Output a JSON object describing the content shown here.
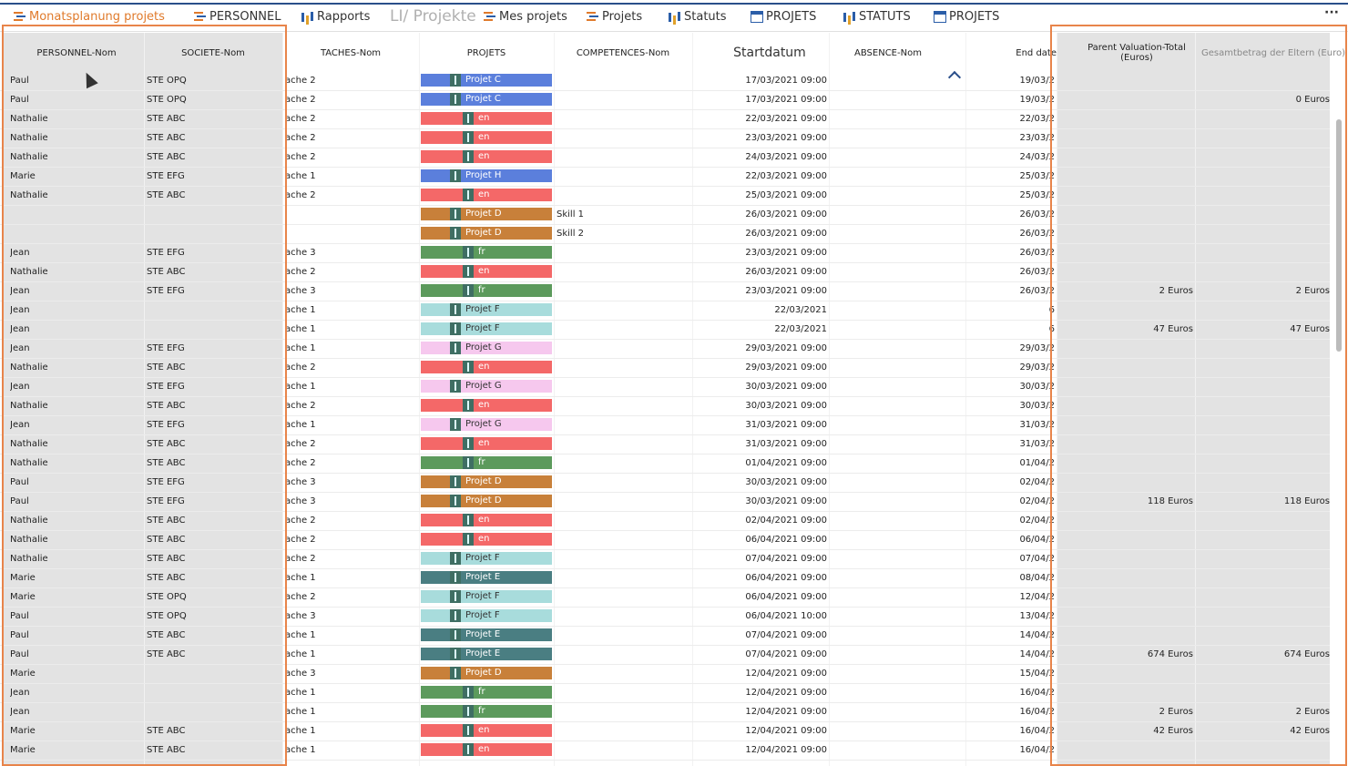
{
  "toolbar": {
    "tabs": [
      {
        "label": "Monatsplanung projets",
        "icon": "gantt-icon",
        "active": true
      },
      {
        "label": "PERSONNEL",
        "icon": "gantt-icon"
      },
      {
        "label": "Rapports",
        "icon": "bar-chart-icon"
      },
      {
        "label": "LI/ Projekte",
        "icon": ""
      },
      {
        "label": "Mes projets",
        "icon": "gantt-icon"
      },
      {
        "label": "Projets",
        "icon": "gantt-icon"
      },
      {
        "label": "Statuts",
        "icon": "bar-chart-icon"
      },
      {
        "label": "PROJETS",
        "icon": "table-icon"
      },
      {
        "label": "STATUTS",
        "icon": "bar-chart-icon"
      },
      {
        "label": "PROJETS",
        "icon": "table-icon"
      }
    ],
    "more_label": "···"
  },
  "columns": [
    "PERSONNEL-Nom",
    "SOCIETE-Nom",
    "TACHES-Nom",
    "PROJETS",
    "COMPETENCES-Nom",
    "Startdatum",
    "ABSENCE-Nom",
    "End date",
    "Parent Valuation-Total (Euros)",
    "Gesamtbetrag der Eltern (Euro)"
  ],
  "colors": {
    "projet_c": "#5b7fdc",
    "en": "#f46868",
    "projet_h": "#5b7fdc",
    "projet_d": "#c8803a",
    "fr": "#5c9a5c",
    "projet_f": "#a8dcdc",
    "projet_g": "#f6c8ee",
    "projet_e": "#4a7e82",
    "accent": "#e8844a"
  },
  "rows": [
    {
      "person": "Paul",
      "company": "STE OPQ",
      "task": "ache 2",
      "project": "Projet C",
      "pc": "projet_c",
      "skill": "",
      "start": "17/03/2021 09:00",
      "end": "19/03/2",
      "total": "",
      "total2": ""
    },
    {
      "person": "Paul",
      "company": "STE OPQ",
      "task": "ache 2",
      "project": "Projet C",
      "pc": "projet_c",
      "skill": "",
      "start": "17/03/2021 09:00",
      "end": "19/03/2",
      "total": "",
      "total2": "0 Euros"
    },
    {
      "person": "Nathalie",
      "company": "STE ABC",
      "task": "ache 2",
      "project": "en",
      "pc": "en",
      "skill": "",
      "start": "22/03/2021 09:00",
      "end": "22/03/2",
      "total": "",
      "total2": ""
    },
    {
      "person": "Nathalie",
      "company": "STE ABC",
      "task": "ache 2",
      "project": "en",
      "pc": "en",
      "skill": "",
      "start": "23/03/2021 09:00",
      "end": "23/03/2",
      "total": "",
      "total2": ""
    },
    {
      "person": "Nathalie",
      "company": "STE ABC",
      "task": "ache 2",
      "project": "en",
      "pc": "en",
      "skill": "",
      "start": "24/03/2021 09:00",
      "end": "24/03/2",
      "total": "",
      "total2": ""
    },
    {
      "person": "Marie",
      "company": "STE EFG",
      "task": "ache 1",
      "project": "Projet H",
      "pc": "projet_h",
      "skill": "",
      "start": "22/03/2021 09:00",
      "end": "25/03/2",
      "total": "",
      "total2": ""
    },
    {
      "person": "Nathalie",
      "company": "STE ABC",
      "task": "ache 2",
      "project": "en",
      "pc": "en",
      "skill": "",
      "start": "25/03/2021 09:00",
      "end": "25/03/2",
      "total": "",
      "total2": ""
    },
    {
      "person": "",
      "company": "",
      "task": "",
      "project": "Projet D",
      "pc": "projet_d",
      "skill": "Skill 1",
      "start": "26/03/2021 09:00",
      "end": "26/03/2",
      "total": "",
      "total2": ""
    },
    {
      "person": "",
      "company": "",
      "task": "",
      "project": "Projet D",
      "pc": "projet_d",
      "skill": "Skill 2",
      "start": "26/03/2021 09:00",
      "end": "26/03/2",
      "total": "",
      "total2": ""
    },
    {
      "person": "Jean",
      "company": "STE EFG",
      "task": "ache 3",
      "project": "fr",
      "pc": "fr",
      "skill": "",
      "start": "23/03/2021 09:00",
      "end": "26/03/2",
      "total": "",
      "total2": ""
    },
    {
      "person": "Nathalie",
      "company": "STE ABC",
      "task": "ache 2",
      "project": "en",
      "pc": "en",
      "skill": "",
      "start": "26/03/2021 09:00",
      "end": "26/03/2",
      "total": "",
      "total2": ""
    },
    {
      "person": "Jean",
      "company": "STE EFG",
      "task": "ache 3",
      "project": "fr",
      "pc": "fr",
      "skill": "",
      "start": "23/03/2021 09:00",
      "end": "26/03/2",
      "total": "2 Euros",
      "total2": "2 Euros"
    },
    {
      "person": "Jean",
      "company": "",
      "task": "ache 1",
      "project": "Projet F",
      "pc": "projet_f",
      "skill": "",
      "start": "22/03/2021",
      "end": "6",
      "total": "",
      "total2": ""
    },
    {
      "person": "Jean",
      "company": "",
      "task": "ache 1",
      "project": "Projet F",
      "pc": "projet_f",
      "skill": "",
      "start": "22/03/2021",
      "end": "6",
      "total": "47 Euros",
      "total2": "47 Euros"
    },
    {
      "person": "Jean",
      "company": "STE EFG",
      "task": "ache 1",
      "project": "Projet G",
      "pc": "projet_g",
      "skill": "",
      "start": "29/03/2021 09:00",
      "end": "29/03/2",
      "total": "",
      "total2": ""
    },
    {
      "person": "Nathalie",
      "company": "STE ABC",
      "task": "ache 2",
      "project": "en",
      "pc": "en",
      "skill": "",
      "start": "29/03/2021 09:00",
      "end": "29/03/2",
      "total": "",
      "total2": ""
    },
    {
      "person": "Jean",
      "company": "STE EFG",
      "task": "ache 1",
      "project": "Projet G",
      "pc": "projet_g",
      "skill": "",
      "start": "30/03/2021 09:00",
      "end": "30/03/2",
      "total": "",
      "total2": ""
    },
    {
      "person": "Nathalie",
      "company": "STE ABC",
      "task": "ache 2",
      "project": "en",
      "pc": "en",
      "skill": "",
      "start": "30/03/2021 09:00",
      "end": "30/03/2",
      "total": "",
      "total2": ""
    },
    {
      "person": "Jean",
      "company": "STE EFG",
      "task": "ache 1",
      "project": "Projet G",
      "pc": "projet_g",
      "skill": "",
      "start": "31/03/2021 09:00",
      "end": "31/03/2",
      "total": "",
      "total2": ""
    },
    {
      "person": "Nathalie",
      "company": "STE ABC",
      "task": "ache 2",
      "project": "en",
      "pc": "en",
      "skill": "",
      "start": "31/03/2021 09:00",
      "end": "31/03/2",
      "total": "",
      "total2": ""
    },
    {
      "person": "Nathalie",
      "company": "STE ABC",
      "task": "ache 2",
      "project": "fr",
      "pc": "fr",
      "skill": "",
      "start": "01/04/2021 09:00",
      "end": "01/04/2",
      "total": "",
      "total2": ""
    },
    {
      "person": "Paul",
      "company": "STE EFG",
      "task": "ache 3",
      "project": "Projet D",
      "pc": "projet_d",
      "skill": "",
      "start": "30/03/2021 09:00",
      "end": "02/04/2",
      "total": "",
      "total2": ""
    },
    {
      "person": "Paul",
      "company": "STE EFG",
      "task": "ache 3",
      "project": "Projet D",
      "pc": "projet_d",
      "skill": "",
      "start": "30/03/2021 09:00",
      "end": "02/04/2",
      "total": "118 Euros",
      "total2": "118 Euros"
    },
    {
      "person": "Nathalie",
      "company": "STE ABC",
      "task": "ache 2",
      "project": "en",
      "pc": "en",
      "skill": "",
      "start": "02/04/2021 09:00",
      "end": "02/04/2",
      "total": "",
      "total2": ""
    },
    {
      "person": "Nathalie",
      "company": "STE ABC",
      "task": "ache 2",
      "project": "en",
      "pc": "en",
      "skill": "",
      "start": "06/04/2021 09:00",
      "end": "06/04/2",
      "total": "",
      "total2": ""
    },
    {
      "person": "Nathalie",
      "company": "STE ABC",
      "task": "ache 2",
      "project": "Projet F",
      "pc": "projet_f",
      "skill": "",
      "start": "07/04/2021 09:00",
      "end": "07/04/2",
      "total": "",
      "total2": ""
    },
    {
      "person": "Marie",
      "company": "STE ABC",
      "task": "ache 1",
      "project": "Projet E",
      "pc": "projet_e",
      "skill": "",
      "start": "06/04/2021 09:00",
      "end": "08/04/2",
      "total": "",
      "total2": ""
    },
    {
      "person": "Marie",
      "company": "STE OPQ",
      "task": "ache 2",
      "project": "Projet F",
      "pc": "projet_f",
      "skill": "",
      "start": "06/04/2021 09:00",
      "end": "12/04/2",
      "total": "",
      "total2": ""
    },
    {
      "person": "Paul",
      "company": "STE OPQ",
      "task": "ache 3",
      "project": "Projet F",
      "pc": "projet_f",
      "skill": "",
      "start": "06/04/2021 10:00",
      "end": "13/04/2",
      "total": "",
      "total2": ""
    },
    {
      "person": "Paul",
      "company": "STE ABC",
      "task": "ache 1",
      "project": "Projet E",
      "pc": "projet_e",
      "skill": "",
      "start": "07/04/2021 09:00",
      "end": "14/04/2",
      "total": "",
      "total2": ""
    },
    {
      "person": "Paul",
      "company": "STE ABC",
      "task": "ache 1",
      "project": "Projet E",
      "pc": "projet_e",
      "skill": "",
      "start": "07/04/2021 09:00",
      "end": "14/04/2",
      "total": "674 Euros",
      "total2": "674 Euros"
    },
    {
      "person": "Marie",
      "company": "",
      "task": "ache 3",
      "project": "Projet D",
      "pc": "projet_d",
      "skill": "",
      "start": "12/04/2021 09:00",
      "end": "15/04/2",
      "total": "",
      "total2": ""
    },
    {
      "person": "Jean",
      "company": "",
      "task": "ache 1",
      "project": "fr",
      "pc": "fr",
      "skill": "",
      "start": "12/04/2021 09:00",
      "end": "16/04/2",
      "total": "",
      "total2": ""
    },
    {
      "person": "Jean",
      "company": "",
      "task": "ache 1",
      "project": "fr",
      "pc": "fr",
      "skill": "",
      "start": "12/04/2021 09:00",
      "end": "16/04/2",
      "total": "2 Euros",
      "total2": "2 Euros"
    },
    {
      "person": "Marie",
      "company": "STE ABC",
      "task": "ache 1",
      "project": "en",
      "pc": "en",
      "skill": "",
      "start": "12/04/2021 09:00",
      "end": "16/04/2",
      "total": "42 Euros",
      "total2": "42 Euros"
    },
    {
      "person": "Marie",
      "company": "STE ABC",
      "task": "ache 1",
      "project": "en",
      "pc": "en",
      "skill": "",
      "start": "12/04/2021 09:00",
      "end": "16/04/2",
      "total": "",
      "total2": ""
    }
  ]
}
